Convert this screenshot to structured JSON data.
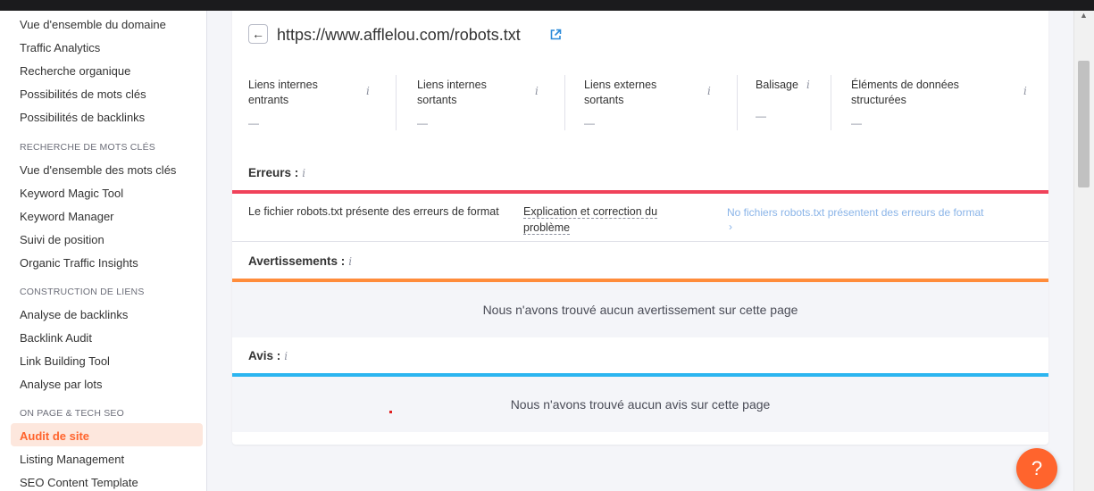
{
  "sidebar": {
    "items_top": [
      "Vue d'ensemble du domaine",
      "Traffic Analytics",
      "Recherche organique",
      "Possibilités de mots clés",
      "Possibilités de backlinks"
    ],
    "section_keywords": "RECHERCHE DE MOTS CLÉS",
    "items_keywords": [
      "Vue d'ensemble des mots clés",
      "Keyword Magic Tool",
      "Keyword Manager",
      "Suivi de position",
      "Organic Traffic Insights"
    ],
    "section_links": "CONSTRUCTION DE LIENS",
    "items_links": [
      "Analyse de backlinks",
      "Backlink Audit",
      "Link Building Tool",
      "Analyse par lots"
    ],
    "section_onpage": "ON PAGE & TECH SEO",
    "active_item": "Audit de site",
    "items_onpage": [
      "Listing Management",
      "SEO Content Template"
    ]
  },
  "page": {
    "back_icon": "arrow-left-icon",
    "url": "https://www.afflelou.com/robots.txt",
    "external_icon": "external-link-icon"
  },
  "metrics": [
    {
      "label": "Liens internes entrants",
      "value": "—"
    },
    {
      "label": "Liens internes sortants",
      "value": "—"
    },
    {
      "label": "Liens externes sortants",
      "value": "—"
    },
    {
      "label": "Balisage",
      "value": "—"
    },
    {
      "label": "Éléments de données structurées",
      "value": "—"
    }
  ],
  "info_glyph": "i",
  "errors": {
    "title": "Erreurs :",
    "color": "#f0425a",
    "issue_text": "Le fichier robots.txt présente des erreurs de format",
    "fix_link": "Explication et correction du problème",
    "status": "No fichiers robots.txt présentent des erreurs de format",
    "status_arrow": "›"
  },
  "warnings": {
    "title": "Avertissements :",
    "color": "#ff8c3b",
    "empty_message": "Nous n'avons trouvé aucun avertissement sur cette page"
  },
  "notices": {
    "title": "Avis :",
    "color": "#2bb5f0",
    "empty_message": "Nous n'avons trouvé aucun avis sur cette page"
  },
  "help": {
    "label": "?",
    "color": "#ff642d"
  }
}
